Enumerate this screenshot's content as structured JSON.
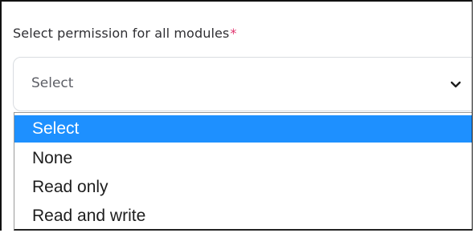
{
  "form": {
    "label": "Select permission for all modules",
    "required_marker": "*",
    "select": {
      "selected_value": "Select",
      "icon": "chevron-down-icon"
    }
  },
  "dropdown": {
    "options": [
      "Select",
      "None",
      "Read only",
      "Read and write"
    ],
    "highlighted_index": 0
  },
  "colors": {
    "highlight": "#1e90ff",
    "required": "#e0336d",
    "border": "#d9dce1"
  }
}
